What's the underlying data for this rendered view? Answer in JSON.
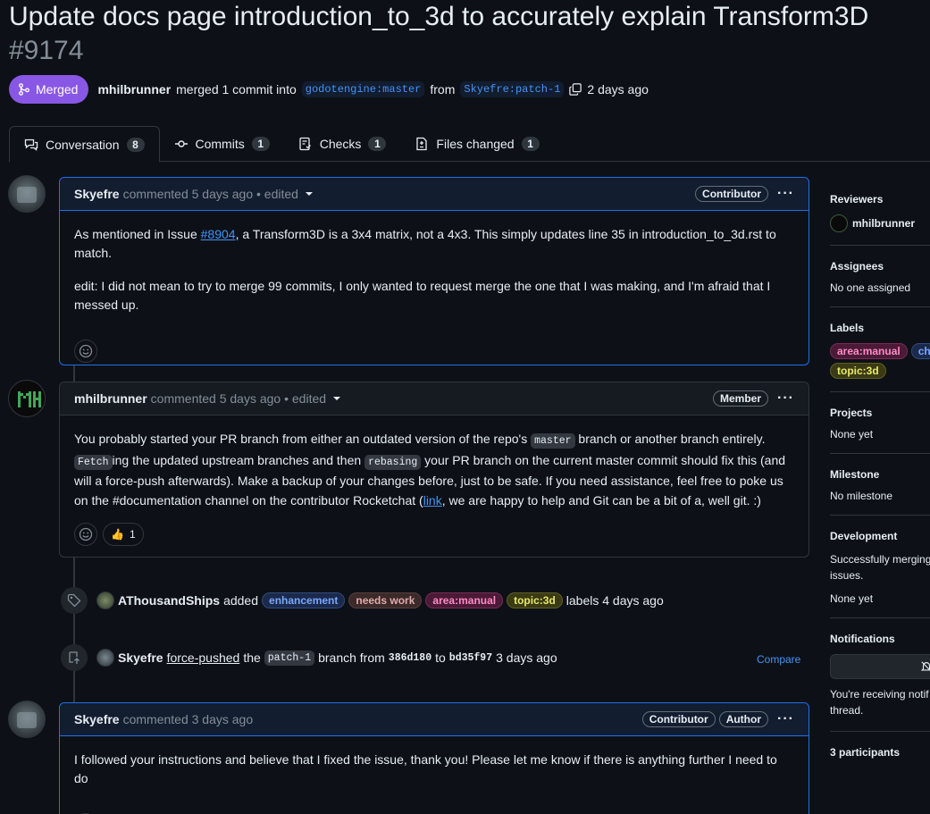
{
  "pr": {
    "title": "Update docs page introduction_to_3d to accurately explain Transform3D",
    "number": "#9174",
    "status": "Merged",
    "author": "mhilbrunner",
    "action_text": "merged 1 commit into",
    "base_branch": "godotengine:master",
    "from_text": "from",
    "head_branch": "Skyefre:patch-1",
    "time": "2 days ago"
  },
  "tabs": [
    {
      "label": "Conversation",
      "count": "8"
    },
    {
      "label": "Commits",
      "count": "1"
    },
    {
      "label": "Checks",
      "count": "1"
    },
    {
      "label": "Files changed",
      "count": "1"
    }
  ],
  "comments": [
    {
      "author": "Skyefre",
      "meta": "commented 5 days ago • edited",
      "role": "Contributor",
      "p1_pre": "As mentioned in Issue ",
      "p1_link": "#8904",
      "p1_post": ", a Transform3D is a 3x4 matrix, not a 4x3. This simply updates line 35 in introduction_to_3d.rst to match.",
      "p2": "edit: I did not mean to try to merge 99 commits, I only wanted to request merge the one that I was making, and I'm afraid that I messed up."
    },
    {
      "author": "mhilbrunner",
      "meta": "commented 5 days ago • edited",
      "role": "Member",
      "t1": "You probably started your PR branch from either an outdated version of the repo's ",
      "c1": "master",
      "t2": " branch or another branch entirely. ",
      "c2": "Fetch",
      "t3": "ing the updated upstream branches and then ",
      "c3": "rebasing",
      "t4": " your PR branch on the current master commit should fix this (and will a force-push afterwards). Make a backup of your changes before, just to be safe. If you need assistance, feel free to poke us on the #documentation channel on the contributor Rocketchat (",
      "link": "link",
      "t5": ", we are happy to help and Git can be a bit of a, well git. :)",
      "reaction_emoji": "👍",
      "reaction_count": "1"
    },
    {
      "author": "Skyefre",
      "meta": "commented 3 days ago",
      "role1": "Contributor",
      "role2": "Author",
      "body": "I followed your instructions and believe that I fixed the issue, thank you! Please let me know if there is anything further I need to do"
    }
  ],
  "events": {
    "labels": {
      "actor": "AThousandShips",
      "verb": "added",
      "labels": [
        "enhancement",
        "needs work",
        "area:manual",
        "topic:3d"
      ],
      "suffix": "labels 4 days ago"
    },
    "push": {
      "actor": "Skyefre",
      "link": "force-pushed",
      "the": "the",
      "branch": "patch-1",
      "from": "branch from",
      "sha1": "386d180",
      "to": "to",
      "sha2": "bd35f97",
      "time": "3 days ago",
      "compare": "Compare"
    }
  },
  "sidebar": {
    "reviewers_h": "Reviewers",
    "reviewer": "mhilbrunner",
    "assignees_h": "Assignees",
    "assignees_v": "No one assigned",
    "labels_h": "Labels",
    "labels": [
      "area:manual",
      "che",
      "topic:3d"
    ],
    "projects_h": "Projects",
    "projects_v": "None yet",
    "milestone_h": "Milestone",
    "milestone_v": "No milestone",
    "development_h": "Development",
    "development_v1": "Successfully merging",
    "development_v2": "issues.",
    "development_v3": "None yet",
    "notifications_h": "Notifications",
    "notifications_v1": "You're receiving notif",
    "notifications_v2": "thread.",
    "participants_h": "3 participants"
  },
  "colors": {
    "merged": "#8957e5",
    "accent": "#4493f8",
    "background": "#0d1117"
  }
}
